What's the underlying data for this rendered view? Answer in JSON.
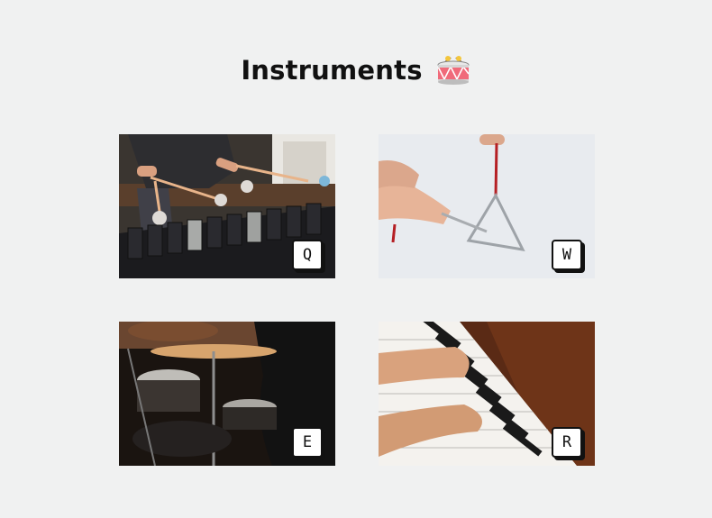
{
  "header": {
    "title": "Instruments",
    "icon": "drum-icon"
  },
  "instruments": [
    {
      "key": "Q",
      "name": "xylophone",
      "icon": "xylophone-image"
    },
    {
      "key": "W",
      "name": "triangle",
      "icon": "triangle-image"
    },
    {
      "key": "E",
      "name": "drums",
      "icon": "drum-kit-image"
    },
    {
      "key": "R",
      "name": "piano",
      "icon": "piano-image"
    }
  ]
}
